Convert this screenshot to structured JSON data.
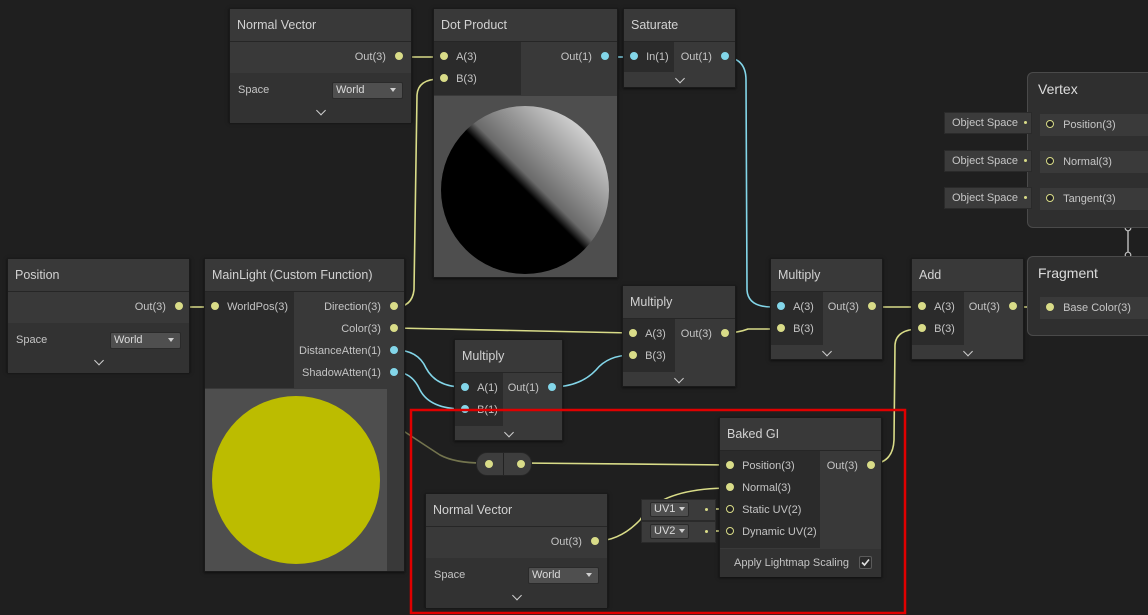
{
  "nodes": {
    "normal_vector_top": {
      "title": "Normal Vector",
      "out": "Out(3)",
      "space_label": "Space",
      "space_value": "World"
    },
    "dot_product": {
      "title": "Dot Product",
      "in_a": "A(3)",
      "in_b": "B(3)",
      "out": "Out(1)"
    },
    "saturate": {
      "title": "Saturate",
      "in": "In(1)",
      "out": "Out(1)"
    },
    "position": {
      "title": "Position",
      "out": "Out(3)",
      "space_label": "Space",
      "space_value": "World"
    },
    "main_light": {
      "title": "MainLight (Custom Function)",
      "in": "WorldPos(3)",
      "out_direction": "Direction(3)",
      "out_color": "Color(3)",
      "out_distance": "DistanceAtten(1)",
      "out_shadow": "ShadowAtten(1)"
    },
    "multiply_small": {
      "title": "Multiply",
      "in_a": "A(1)",
      "in_b": "B(1)",
      "out": "Out(1)"
    },
    "multiply_mid": {
      "title": "Multiply",
      "in_a": "A(3)",
      "in_b": "B(3)",
      "out": "Out(3)"
    },
    "multiply_right": {
      "title": "Multiply",
      "in_a": "A(3)",
      "in_b": "B(3)",
      "out": "Out(3)"
    },
    "add": {
      "title": "Add",
      "in_a": "A(3)",
      "in_b": "B(3)",
      "out": "Out(3)"
    },
    "baked_gi": {
      "title": "Baked GI",
      "in_position": "Position(3)",
      "in_normal": "Normal(3)",
      "in_static_uv": "Static UV(2)",
      "in_dynamic_uv": "Dynamic UV(2)",
      "out": "Out(3)",
      "apply_lightmap_label": "Apply Lightmap Scaling",
      "apply_lightmap_checked": true,
      "uv1_value": "UV1",
      "uv2_value": "UV2"
    },
    "normal_vector_bottom": {
      "title": "Normal Vector",
      "out": "Out(3)",
      "space_label": "Space",
      "space_value": "World"
    }
  },
  "master": {
    "vertex_title": "Vertex",
    "vertex_slots": [
      "Position(3)",
      "Normal(3)",
      "Tangent(3)"
    ],
    "vertex_inputs": [
      "Object Space",
      "Object Space",
      "Object Space"
    ],
    "fragment_title": "Fragment",
    "fragment_slots": [
      "Base Color(3)"
    ]
  },
  "colors": {
    "background": "#1f1f1f",
    "vector_port": "#d9dc88",
    "float_port": "#83d6e9",
    "highlight_box": "#e00000",
    "light_preview": "#bcbc00"
  }
}
